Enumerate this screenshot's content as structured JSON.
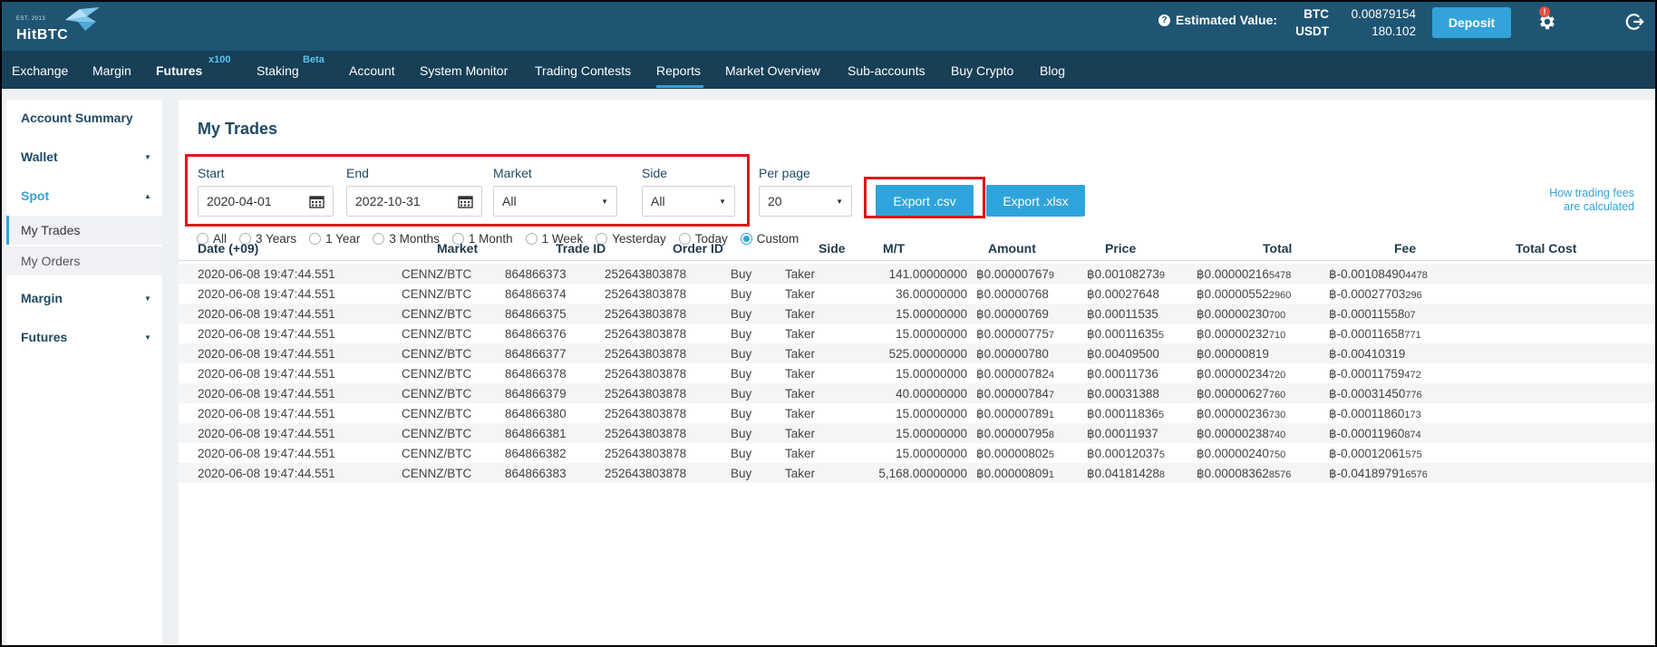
{
  "header": {
    "logo_est": "EST. 2013",
    "logo_brand": "HitBTC",
    "estimated_label": "Estimated Value:",
    "balances": [
      {
        "currency": "BTC",
        "amount": "0.00879154"
      },
      {
        "currency": "USDT",
        "amount": "180.102"
      }
    ],
    "deposit_label": "Deposit",
    "notification_badge": "!"
  },
  "nav": [
    {
      "label": "Exchange"
    },
    {
      "label": "Margin"
    },
    {
      "label": "Futures",
      "sup": "x100"
    },
    {
      "label": "Staking",
      "sup": "Beta"
    },
    {
      "label": "Account"
    },
    {
      "label": "System Monitor"
    },
    {
      "label": "Trading Contests"
    },
    {
      "label": "Reports"
    },
    {
      "label": "Market Overview"
    },
    {
      "label": "Sub-accounts"
    },
    {
      "label": "Buy Crypto"
    },
    {
      "label": "Blog"
    }
  ],
  "sidebar": {
    "account_summary": "Account Summary",
    "wallet": "Wallet",
    "spot": "Spot",
    "my_trades": "My Trades",
    "my_orders": "My Orders",
    "margin": "Margin",
    "futures": "Futures"
  },
  "main": {
    "title": "My Trades",
    "filters": {
      "start_label": "Start",
      "start_value": "2020-04-01",
      "end_label": "End",
      "end_value": "2022-10-31",
      "market_label": "Market",
      "market_value": "All",
      "side_label": "Side",
      "side_value": "All",
      "perpage_label": "Per page",
      "perpage_value": "20"
    },
    "export_csv": "Export .csv",
    "export_xlsx": "Export .xlsx",
    "fees_link_1": "How trading fees",
    "fees_link_2": "are calculated",
    "ranges": [
      "All",
      "3 Years",
      "1 Year",
      "3 Months",
      "1 Month",
      "1 Week",
      "Yesterday",
      "Today",
      "Custom"
    ],
    "selected_range": "Custom"
  },
  "table": {
    "columns": [
      "Date (+09)",
      "Market",
      "Trade ID",
      "Order ID",
      "Side",
      "M/T",
      "Amount",
      "Price",
      "Total",
      "Fee",
      "Total Cost"
    ],
    "rows": [
      [
        "2020-06-08 19:47:44.551",
        "CENNZ/BTC",
        "864866373",
        "252643803878",
        "Buy",
        "Taker",
        "141.00000000",
        "฿0.00000767",
        "9",
        "฿0.00108273",
        "9",
        "฿0.00000216",
        "5478",
        "฿-0.00108490",
        "4478"
      ],
      [
        "2020-06-08 19:47:44.551",
        "CENNZ/BTC",
        "864866374",
        "252643803878",
        "Buy",
        "Taker",
        "36.00000000",
        "฿0.00000768",
        "",
        "฿0.00027648",
        "",
        "฿0.00000552",
        "2960",
        "฿-0.00027703",
        "296"
      ],
      [
        "2020-06-08 19:47:44.551",
        "CENNZ/BTC",
        "864866375",
        "252643803878",
        "Buy",
        "Taker",
        "15.00000000",
        "฿0.00000769",
        "",
        "฿0.00011535",
        "",
        "฿0.00000230",
        "700",
        "฿-0.00011558",
        "07"
      ],
      [
        "2020-06-08 19:47:44.551",
        "CENNZ/BTC",
        "864866376",
        "252643803878",
        "Buy",
        "Taker",
        "15.00000000",
        "฿0.00000775",
        "7",
        "฿0.00011635",
        "5",
        "฿0.00000232",
        "710",
        "฿-0.00011658",
        "771"
      ],
      [
        "2020-06-08 19:47:44.551",
        "CENNZ/BTC",
        "864866377",
        "252643803878",
        "Buy",
        "Taker",
        "525.00000000",
        "฿0.00000780",
        "",
        "฿0.00409500",
        "",
        "฿0.00000819",
        "",
        "฿-0.00410319",
        ""
      ],
      [
        "2020-06-08 19:47:44.551",
        "CENNZ/BTC",
        "864866378",
        "252643803878",
        "Buy",
        "Taker",
        "15.00000000",
        "฿0.00000782",
        "4",
        "฿0.00011736",
        "",
        "฿0.00000234",
        "720",
        "฿-0.00011759",
        "472"
      ],
      [
        "2020-06-08 19:47:44.551",
        "CENNZ/BTC",
        "864866379",
        "252643803878",
        "Buy",
        "Taker",
        "40.00000000",
        "฿0.00000784",
        "7",
        "฿0.00031388",
        "",
        "฿0.00000627",
        "760",
        "฿-0.00031450",
        "776"
      ],
      [
        "2020-06-08 19:47:44.551",
        "CENNZ/BTC",
        "864866380",
        "252643803878",
        "Buy",
        "Taker",
        "15.00000000",
        "฿0.00000789",
        "1",
        "฿0.00011836",
        "5",
        "฿0.00000236",
        "730",
        "฿-0.00011860",
        "173"
      ],
      [
        "2020-06-08 19:47:44.551",
        "CENNZ/BTC",
        "864866381",
        "252643803878",
        "Buy",
        "Taker",
        "15.00000000",
        "฿0.00000795",
        "8",
        "฿0.00011937",
        "",
        "฿0.00000238",
        "740",
        "฿-0.00011960",
        "874"
      ],
      [
        "2020-06-08 19:47:44.551",
        "CENNZ/BTC",
        "864866382",
        "252643803878",
        "Buy",
        "Taker",
        "15.00000000",
        "฿0.00000802",
        "5",
        "฿0.00012037",
        "5",
        "฿0.00000240",
        "750",
        "฿-0.00012061",
        "575"
      ],
      [
        "2020-06-08 19:47:44.551",
        "CENNZ/BTC",
        "864866383",
        "252643803878",
        "Buy",
        "Taker",
        "5,168.00000000",
        "฿0.00000809",
        "1",
        "฿0.04181428",
        "8",
        "฿0.00008362",
        "8576",
        "฿-0.04189791",
        "6576"
      ]
    ]
  },
  "colors": {
    "topbar": "#1f5573",
    "nav": "#173f56",
    "accent": "#33a3d9",
    "highlight": "#e0151b"
  }
}
